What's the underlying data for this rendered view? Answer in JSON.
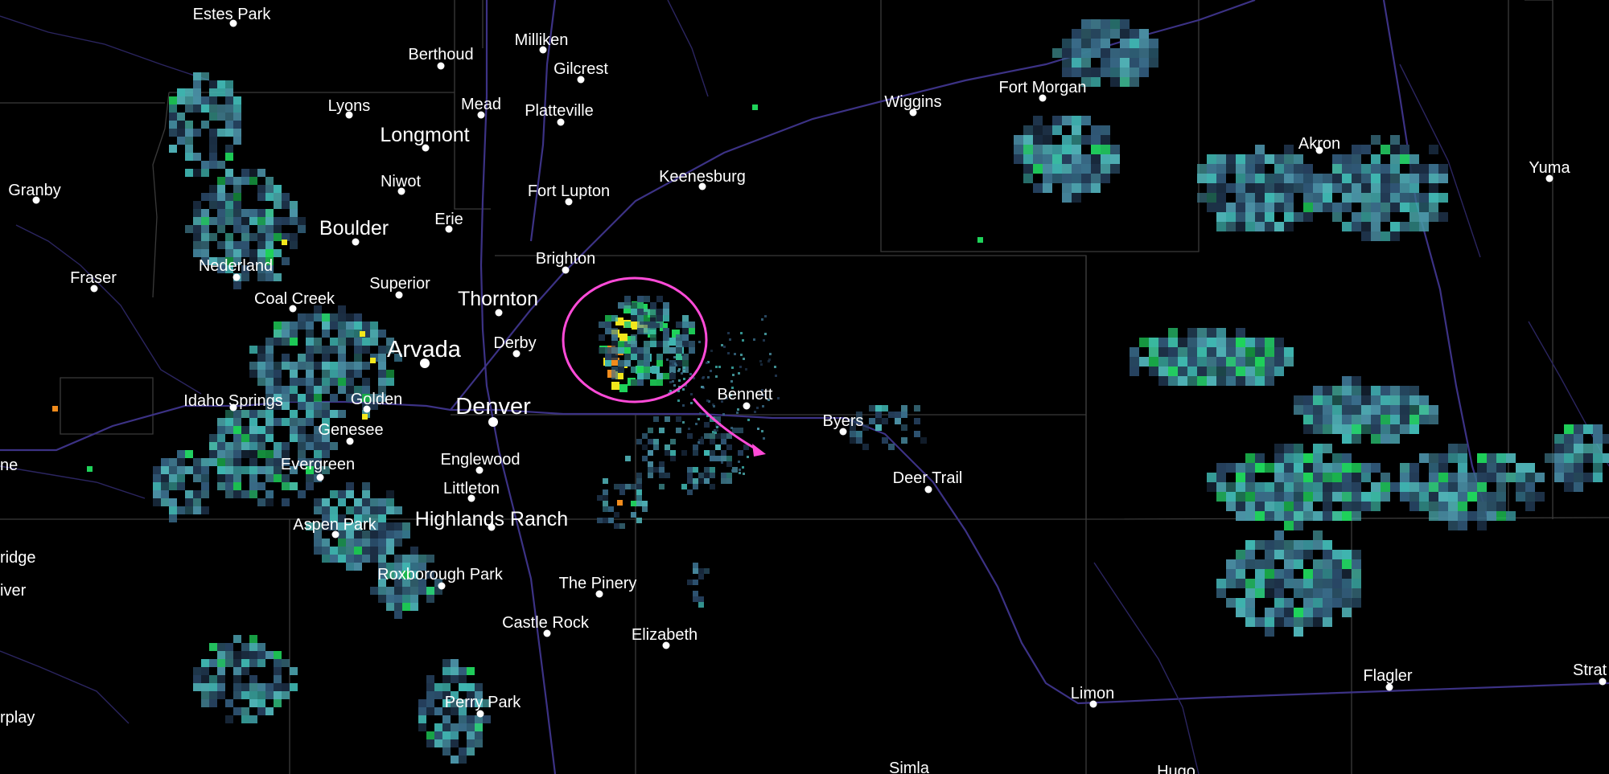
{
  "map": {
    "type": "weather-radar",
    "background": "#000000",
    "colors": {
      "road": "#3c3285",
      "county_line": "#3a3a3a",
      "annotation": "#ff4bd8",
      "reflectivity_low": "#2a4a66",
      "reflectivity_mid": "#3fb5b0",
      "reflectivity_green": "#1fd35a",
      "reflectivity_yellow": "#f2e71c",
      "reflectivity_orange": "#f28c1c"
    },
    "cities": [
      {
        "name": "Estes Park",
        "size": "sm"
      },
      {
        "name": "Milliken",
        "size": "sm"
      },
      {
        "name": "Berthoud",
        "size": "sm"
      },
      {
        "name": "Gilcrest",
        "size": "sm"
      },
      {
        "name": "Lyons",
        "size": "sm"
      },
      {
        "name": "Mead",
        "size": "sm"
      },
      {
        "name": "Platteville",
        "size": "sm"
      },
      {
        "name": "Longmont",
        "size": "md"
      },
      {
        "name": "Wiggins",
        "size": "sm"
      },
      {
        "name": "Fort Morgan",
        "size": "sm"
      },
      {
        "name": "Akron",
        "size": "sm"
      },
      {
        "name": "Yuma",
        "size": "sm"
      },
      {
        "name": "Granby",
        "size": "sm"
      },
      {
        "name": "Niwot",
        "size": "sm"
      },
      {
        "name": "Fort Lupton",
        "size": "sm"
      },
      {
        "name": "Keenesburg",
        "size": "sm"
      },
      {
        "name": "Erie",
        "size": "sm"
      },
      {
        "name": "Boulder",
        "size": "md"
      },
      {
        "name": "Brighton",
        "size": "sm"
      },
      {
        "name": "Nederland",
        "size": "sm"
      },
      {
        "name": "Fraser",
        "size": "sm"
      },
      {
        "name": "Superior",
        "size": "sm"
      },
      {
        "name": "Coal Creek",
        "size": "sm"
      },
      {
        "name": "Thornton",
        "size": "md"
      },
      {
        "name": "Derby",
        "size": "sm"
      },
      {
        "name": "Arvada",
        "size": "lg"
      },
      {
        "name": "Bennett",
        "size": "sm"
      },
      {
        "name": "Idaho Springs",
        "size": "sm"
      },
      {
        "name": "Golden",
        "size": "sm"
      },
      {
        "name": "Denver",
        "size": "lg"
      },
      {
        "name": "Byers",
        "size": "sm"
      },
      {
        "name": "Genesee",
        "size": "sm"
      },
      {
        "name": "Englewood",
        "size": "sm"
      },
      {
        "name": "Evergreen",
        "size": "sm"
      },
      {
        "name": "Littleton",
        "size": "sm"
      },
      {
        "name": "Deer Trail",
        "size": "sm"
      },
      {
        "name": "Highlands Ranch",
        "size": "md"
      },
      {
        "name": "Aspen Park",
        "size": "sm"
      },
      {
        "name": "Roxborough Park",
        "size": "sm"
      },
      {
        "name": "The Pinery",
        "size": "sm"
      },
      {
        "name": "Castle Rock",
        "size": "sm"
      },
      {
        "name": "Elizabeth",
        "size": "sm"
      },
      {
        "name": "Flagler",
        "size": "sm"
      },
      {
        "name": "Limon",
        "size": "sm"
      },
      {
        "name": "Strat",
        "size": "sm"
      },
      {
        "name": "Perry Park",
        "size": "sm"
      },
      {
        "name": "Simla",
        "size": "sm"
      },
      {
        "name": "Hugo",
        "size": "sm"
      },
      {
        "name": "ne",
        "size": "sm"
      },
      {
        "name": "ridge",
        "size": "sm"
      },
      {
        "name": "iver",
        "size": "sm"
      },
      {
        "name": "rplay",
        "size": "sm"
      }
    ]
  }
}
